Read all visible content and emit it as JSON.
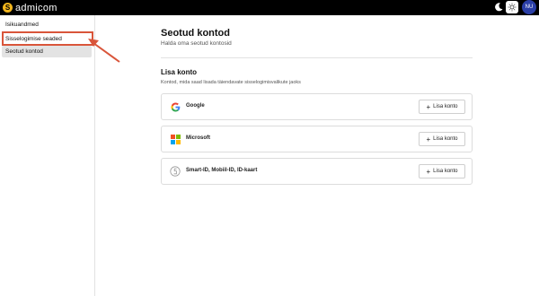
{
  "app": {
    "logo_letter": "S",
    "name": "admicom",
    "avatar_initials": "NU",
    "theme_icons": [
      "moon-icon",
      "sun-icon"
    ]
  },
  "sidebar": {
    "items": [
      {
        "label": "Isikuandmed",
        "active": false
      },
      {
        "label": "Sisselogimise seaded",
        "active": false
      },
      {
        "label": "Seotud kontod",
        "active": true
      }
    ]
  },
  "main": {
    "title": "Seotud kontod",
    "subtitle": "Halda oma seotud kontosid",
    "section_title": "Lisa konto",
    "section_desc": "Kontod, mida saad lisada täiendavate sisselogimisvalikute jaoks",
    "accounts": [
      {
        "name": "Google",
        "icon": "google-icon",
        "button": "Lisa konto"
      },
      {
        "name": "Microsoft",
        "icon": "microsoft-icon",
        "button": "Lisa konto"
      },
      {
        "name": "Smart-ID, Mobiil-ID, ID-kaart",
        "icon": "smart-id-icon",
        "button": "Lisa konto"
      }
    ]
  },
  "colors": {
    "topbar": "#000000",
    "logo_accent": "#f2b61d",
    "avatar": "#2b3fa6",
    "annotation": "#d9553a",
    "active_item_bg": "#e3e3e3"
  }
}
